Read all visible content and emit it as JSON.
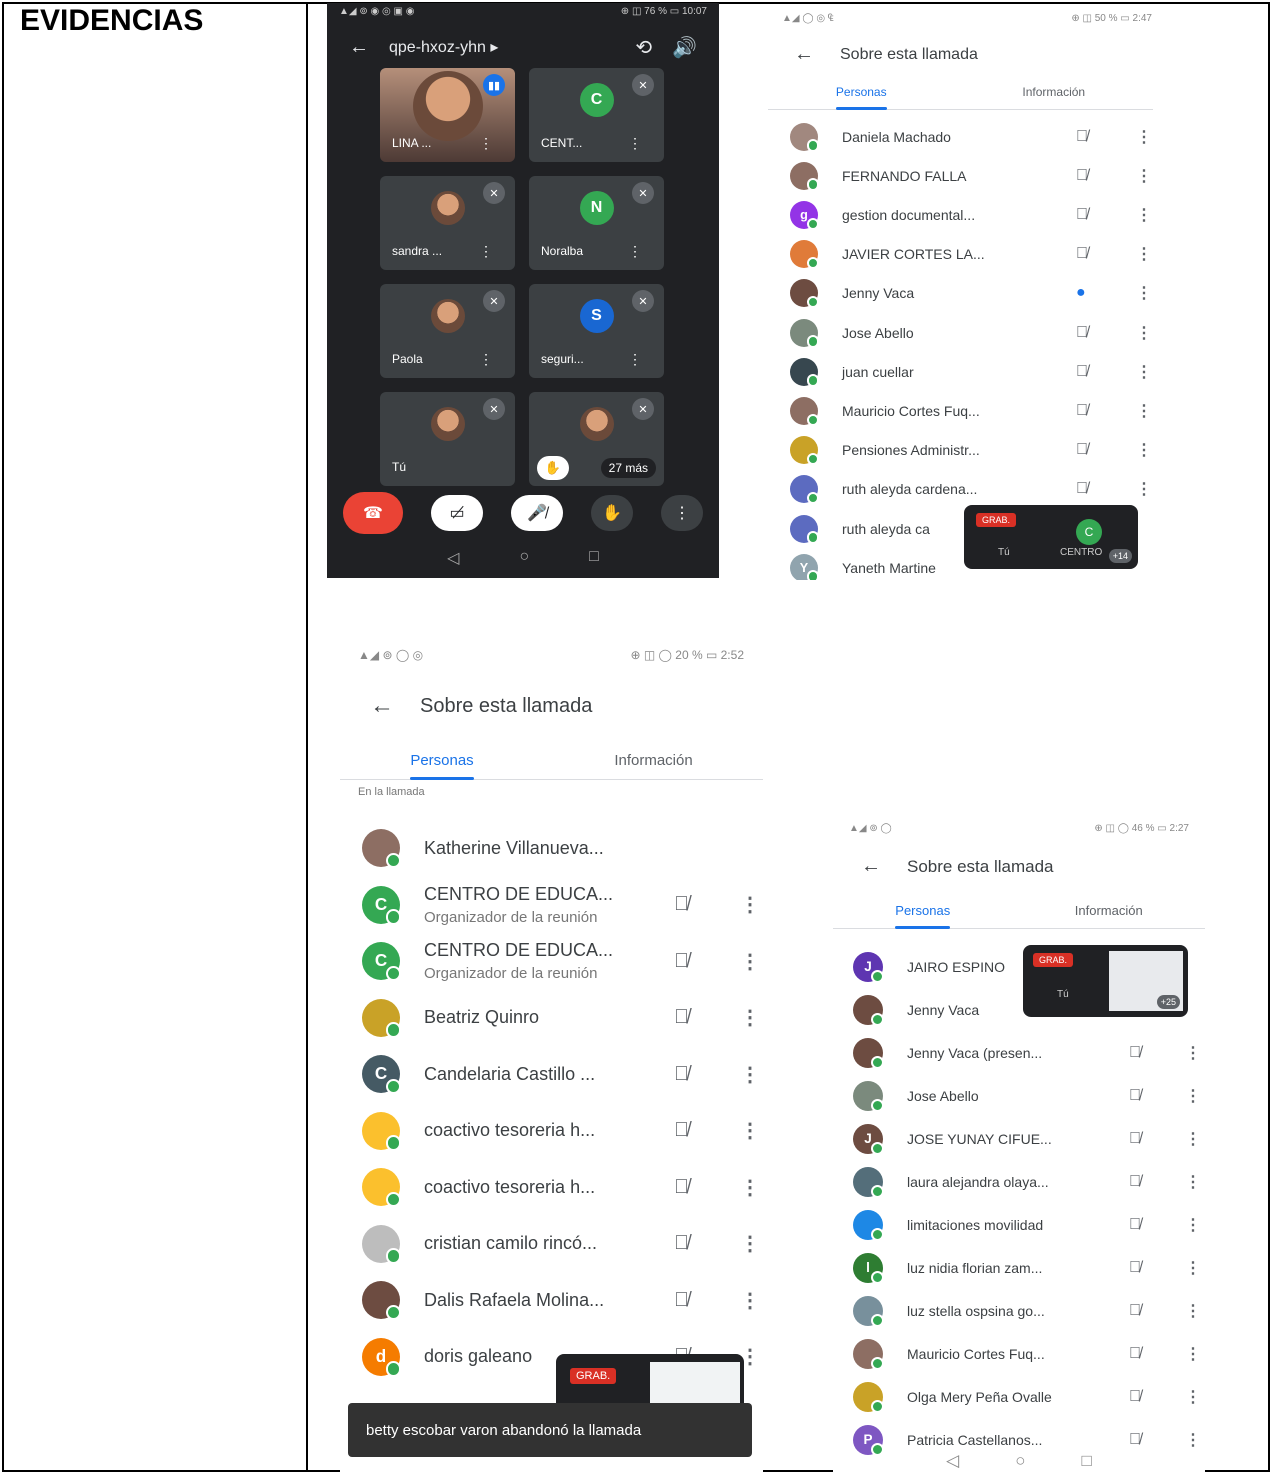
{
  "label": "EVIDENCIAS",
  "s1": {
    "status_left": "▲◢ ⊚ ◉ ◎ ▣ ◉",
    "status_right": "⊕ ◫ 76 % ▭ 10:07",
    "meeting_code": "qpe-hxoz-yhn ▸",
    "tiles": [
      {
        "name": "LINA ...",
        "initial": ""
      },
      {
        "name": "CENT...",
        "initial": "C"
      },
      {
        "name": "sandra ...",
        "initial": ""
      },
      {
        "name": "Noralba",
        "initial": "N"
      },
      {
        "name": "Paola",
        "initial": ""
      },
      {
        "name": "seguri...",
        "initial": "S"
      },
      {
        "name": "Tú",
        "initial": ""
      }
    ],
    "more": "27 más"
  },
  "s2": {
    "status_left": "▲◢ ◯ ◎ ₠",
    "status_right": "⊕ ◫ 50 % ▭ 2:47",
    "title": "Sobre esta llamada",
    "tabs": [
      "Personas",
      "Información"
    ],
    "rec": "GRAB.",
    "self": "Tú",
    "pip_initial": "C",
    "pip_name": "CENTRO",
    "pip_count": "+14",
    "people": [
      {
        "name": "Daniela Machado",
        "initial": "",
        "color": "#a1887f",
        "state": "off"
      },
      {
        "name": "FERNANDO FALLA",
        "initial": "",
        "color": "#8d6e63",
        "state": "off"
      },
      {
        "name": "gestion documental...",
        "initial": "g",
        "color": "#9334e6",
        "state": "off"
      },
      {
        "name": "JAVIER CORTES LA...",
        "initial": "",
        "color": "#e07b39",
        "state": "off"
      },
      {
        "name": "Jenny Vaca",
        "initial": "",
        "color": "#6d4c41",
        "state": "speak"
      },
      {
        "name": "Jose Abello",
        "initial": "",
        "color": "#7b8a7d",
        "state": "off"
      },
      {
        "name": "juan cuellar",
        "initial": "",
        "color": "#37474f",
        "state": "off"
      },
      {
        "name": "Mauricio Cortes Fuq...",
        "initial": "",
        "color": "#8d6e63",
        "state": "off"
      },
      {
        "name": "Pensiones Administr...",
        "initial": "",
        "color": "#c9a227",
        "state": "off"
      },
      {
        "name": "ruth aleyda cardena...",
        "initial": "",
        "color": "#5c6bc0",
        "state": "off"
      },
      {
        "name": "ruth aleyda ca",
        "initial": "",
        "color": "#5c6bc0",
        "state": "none"
      },
      {
        "name": "Yaneth Martine",
        "initial": "Y",
        "color": "#90a4ae",
        "state": "none"
      }
    ]
  },
  "s3": {
    "status_left": "▲◢ ⊚ ◯ ◎",
    "status_right": "⊕ ◫ ◯ 20 % ▭ 2:52",
    "title": "Sobre esta llamada",
    "tabs": [
      "Personas",
      "Información"
    ],
    "section": "En la llamada",
    "rec": "GRAB.",
    "toast": "betty escobar varon abandonó la llamada",
    "people": [
      {
        "name": "Katherine Villanueva...",
        "sub": "",
        "initial": "",
        "color": "#8d6e63",
        "state": "none"
      },
      {
        "name": "CENTRO DE EDUCA...",
        "sub": "Organizador de la reunión",
        "initial": "C",
        "color": "#34a853",
        "state": "off"
      },
      {
        "name": "CENTRO DE EDUCA...",
        "sub": "Organizador de la reunión",
        "initial": "C",
        "color": "#34a853",
        "state": "off"
      },
      {
        "name": "Beatriz Quinro",
        "sub": "",
        "initial": "",
        "color": "#c9a227",
        "state": "off"
      },
      {
        "name": "Candelaria Castillo ...",
        "sub": "",
        "initial": "C",
        "color": "#455a64",
        "state": "off"
      },
      {
        "name": "coactivo tesoreria h...",
        "sub": "",
        "initial": "",
        "color": "#fbc02d",
        "state": "off"
      },
      {
        "name": "coactivo tesoreria h...",
        "sub": "",
        "initial": "",
        "color": "#fbc02d",
        "state": "off"
      },
      {
        "name": "cristian camilo rincó...",
        "sub": "",
        "initial": "",
        "color": "#bdbdbd",
        "state": "off"
      },
      {
        "name": "Dalis Rafaela Molina...",
        "sub": "",
        "initial": "",
        "color": "#6d4c41",
        "state": "off"
      },
      {
        "name": "doris galeano",
        "sub": "",
        "initial": "d",
        "color": "#f57c00",
        "state": "off"
      }
    ]
  },
  "s4": {
    "status_left": "▲◢ ⊚ ◯",
    "status_right": "⊕ ◫ ◯ 46 % ▭ 2:27",
    "title": "Sobre esta llamada",
    "tabs": [
      "Personas",
      "Información"
    ],
    "rec": "GRAB.",
    "self": "Tú",
    "pip_count": "+25",
    "people": [
      {
        "name": "JAIRO ESPINO",
        "initial": "J",
        "color": "#5e35b1",
        "state": "none"
      },
      {
        "name": "Jenny Vaca",
        "initial": "",
        "color": "#6d4c41",
        "state": "none"
      },
      {
        "name": "Jenny Vaca (presen...",
        "initial": "",
        "color": "#6d4c41",
        "state": "off"
      },
      {
        "name": "Jose Abello",
        "initial": "",
        "color": "#7b8a7d",
        "state": "off"
      },
      {
        "name": "JOSE YUNAY CIFUE...",
        "initial": "J",
        "color": "#6d4c41",
        "state": "off"
      },
      {
        "name": "laura alejandra olaya...",
        "initial": "",
        "color": "#546e7a",
        "state": "off"
      },
      {
        "name": "limitaciones movilidad",
        "initial": "",
        "color": "#1e88e5",
        "state": "off"
      },
      {
        "name": "luz nidia florian zam...",
        "initial": "l",
        "color": "#2e7d32",
        "state": "off"
      },
      {
        "name": "luz stella ospsina go...",
        "initial": "",
        "color": "#78909c",
        "state": "off"
      },
      {
        "name": "Mauricio Cortes Fuq...",
        "initial": "",
        "color": "#8d6e63",
        "state": "off"
      },
      {
        "name": "Olga Mery Peña Ovalle",
        "initial": "",
        "color": "#c9a227",
        "state": "off"
      },
      {
        "name": "Patricia Castellanos...",
        "initial": "P",
        "color": "#7e57c2",
        "state": "off"
      }
    ]
  }
}
